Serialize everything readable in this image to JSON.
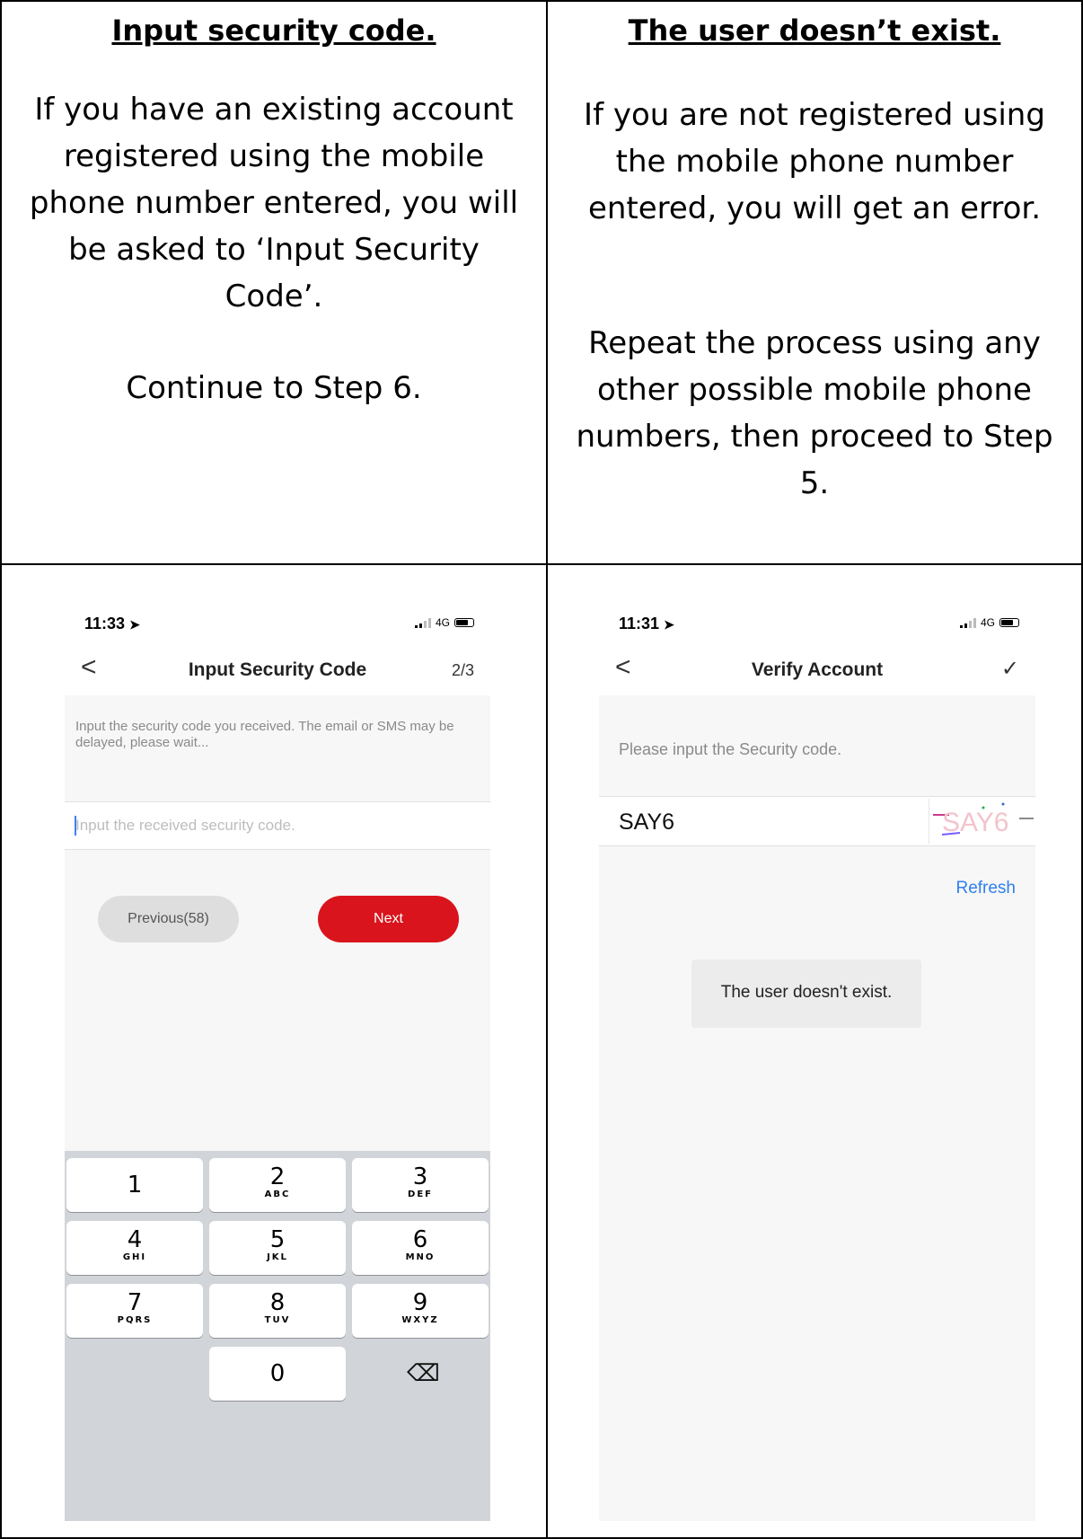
{
  "left_column": {
    "heading": "Input security code.",
    "paragraph_1": "If you have an existing account registered using the mobile phone number entered, you will be asked to ‘Input Security Code’.",
    "paragraph_2": "Continue to Step 6."
  },
  "right_column": {
    "heading": "The user doesn’t exist.",
    "paragraph_1": "If you are not registered using the mobile phone number entered, you will get an error.",
    "paragraph_2": "Repeat the process using any other possible mobile phone numbers, then proceed to Step 5."
  },
  "phone_left": {
    "status": {
      "time": "11:33",
      "network": "4G",
      "location_icon": "location-arrow-icon"
    },
    "nav": {
      "back": "<",
      "title": "Input Security Code",
      "step": "2/3"
    },
    "hint": "Input the security code you received. The email or SMS may be delayed, please wait...",
    "input": {
      "placeholder": "Input the received security code.",
      "value": ""
    },
    "buttons": {
      "previous": "Previous(58)",
      "next": "Next"
    },
    "colors": {
      "next_button": "#d9141c",
      "caret": "#3b82f6"
    },
    "keypad": {
      "keys": [
        {
          "num": "1",
          "letters": ""
        },
        {
          "num": "2",
          "letters": "ABC"
        },
        {
          "num": "3",
          "letters": "DEF"
        },
        {
          "num": "4",
          "letters": "GHI"
        },
        {
          "num": "5",
          "letters": "JKL"
        },
        {
          "num": "6",
          "letters": "MNO"
        },
        {
          "num": "7",
          "letters": "PQRS"
        },
        {
          "num": "8",
          "letters": "TUV"
        },
        {
          "num": "9",
          "letters": "WXYZ"
        },
        {
          "num": "0",
          "letters": ""
        }
      ],
      "delete_icon": "⌫"
    }
  },
  "phone_right": {
    "status": {
      "time": "11:31",
      "network": "4G",
      "location_icon": "location-arrow-icon"
    },
    "nav": {
      "back": "<",
      "title": "Verify Account",
      "confirm": "✓"
    },
    "hint": "Please input the Security code.",
    "code_value": "SAY6",
    "captcha_text": "SAY6",
    "refresh": "Refresh",
    "toast": "The user doesn't exist.",
    "colors": {
      "refresh_link": "#2f80ed"
    }
  }
}
